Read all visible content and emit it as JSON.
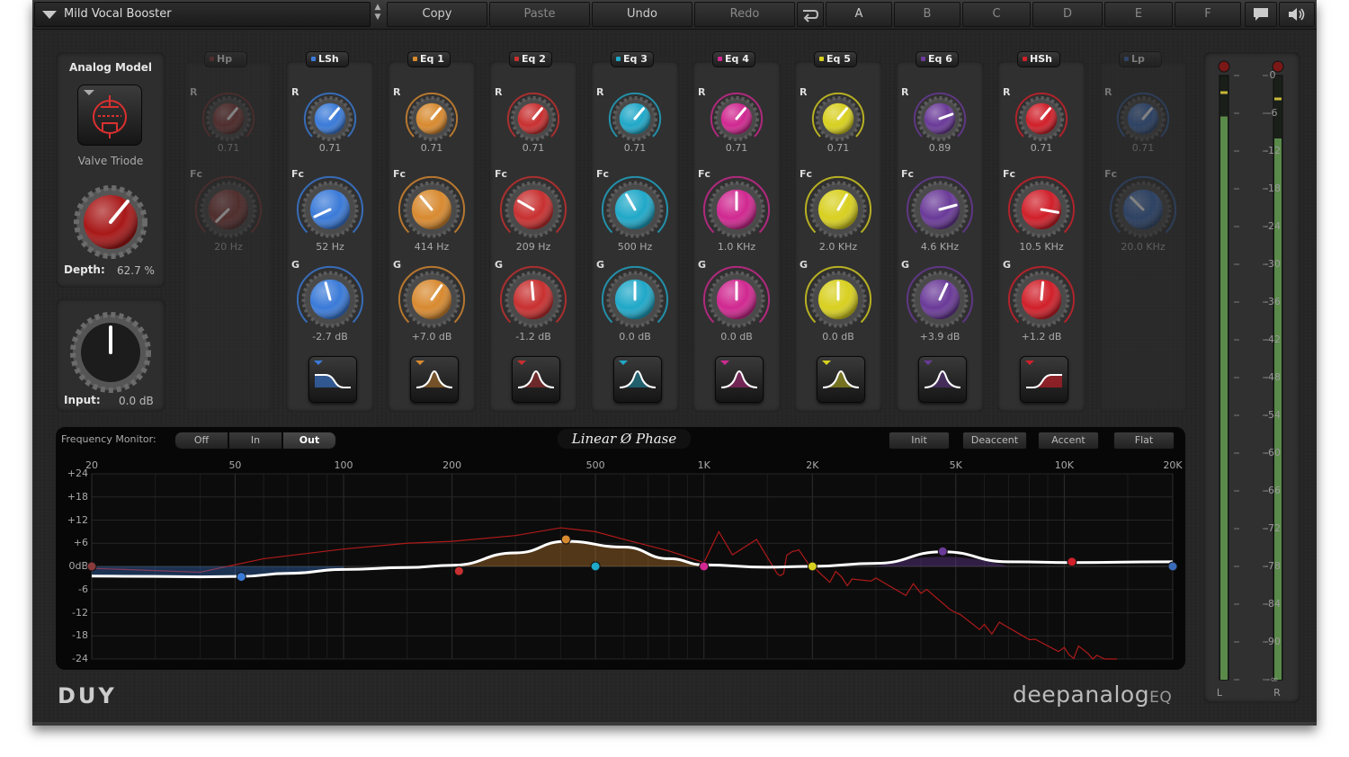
{
  "topbar": {
    "preset_name": "Mild Vocal Booster",
    "buttons": [
      {
        "label": "Copy",
        "enabled": true
      },
      {
        "label": "Paste",
        "enabled": false
      },
      {
        "label": "Undo",
        "enabled": true
      },
      {
        "label": "Redo",
        "enabled": false
      }
    ],
    "ab_slots": [
      "A",
      "B",
      "C",
      "D",
      "E",
      "F"
    ],
    "icons": [
      "swap-icon",
      "comment-icon",
      "speaker-icon"
    ]
  },
  "analog": {
    "title": "Analog Model",
    "model": "Valve Triode",
    "depth_label": "Depth:",
    "depth_value": "62.7 %",
    "input_label": "Input:",
    "input_value": "0.0 dB"
  },
  "bands": [
    {
      "tag": "Hp",
      "enabled": false,
      "color": "#8a3a3a",
      "r": "0.71",
      "fc": "20 Hz",
      "g": null,
      "shape": null
    },
    {
      "tag": "LSh",
      "enabled": true,
      "color": "#3a7ad8",
      "r": "0.71",
      "fc": "52 Hz",
      "g": "-2.7 dB",
      "shape": "low-shelf"
    },
    {
      "tag": "Eq 1",
      "enabled": true,
      "color": "#d88a30",
      "r": "0.71",
      "fc": "414 Hz",
      "g": "+7.0 dB",
      "shape": "peak"
    },
    {
      "tag": "Eq 2",
      "enabled": true,
      "color": "#c83030",
      "r": "0.71",
      "fc": "209 Hz",
      "g": "-1.2 dB",
      "shape": "peak"
    },
    {
      "tag": "Eq 3",
      "enabled": true,
      "color": "#20a8c8",
      "r": "0.71",
      "fc": "500 Hz",
      "g": "0.0 dB",
      "shape": "peak"
    },
    {
      "tag": "Eq 4",
      "enabled": true,
      "color": "#d02890",
      "r": "0.71",
      "fc": "1.0 KHz",
      "g": "0.0 dB",
      "shape": "peak"
    },
    {
      "tag": "Eq 5",
      "enabled": true,
      "color": "#d8d020",
      "r": "0.71",
      "fc": "2.0 KHz",
      "g": "0.0 dB",
      "shape": "peak"
    },
    {
      "tag": "Eq 6",
      "enabled": true,
      "color": "#6a3a98",
      "r": "0.89",
      "fc": "4.6 KHz",
      "g": "+3.9 dB",
      "shape": "peak"
    },
    {
      "tag": "HSh",
      "enabled": true,
      "color": "#d0202a",
      "r": "0.71",
      "fc": "10.5 KHz",
      "g": "+1.2 dB",
      "shape": "high-shelf"
    },
    {
      "tag": "Lp",
      "enabled": false,
      "color": "#3a6ab8",
      "r": "0.71",
      "fc": "20.0 KHz",
      "g": null,
      "shape": null
    }
  ],
  "knob_labels": {
    "r": "R",
    "fc": "Fc",
    "g": "G"
  },
  "monitor": {
    "label": "Frequency Monitor:",
    "options": [
      "Off",
      "In",
      "Out"
    ],
    "selected": "Out",
    "phase_mode": "Linear Ø Phase",
    "buttons": [
      "Init",
      "Deaccent",
      "Accent",
      "Flat"
    ]
  },
  "chart_data": {
    "type": "line",
    "x_scale": "log",
    "xlim": [
      20,
      20000
    ],
    "ylim": [
      -24,
      24
    ],
    "x_ticks": [
      "20",
      "50",
      "100",
      "200",
      "500",
      "1K",
      "2K",
      "5K",
      "10K",
      "20K"
    ],
    "x_tick_values": [
      20,
      50,
      100,
      200,
      500,
      1000,
      2000,
      5000,
      10000,
      20000
    ],
    "y_ticks": [
      "+24",
      "+18",
      "+12",
      "+6",
      "0dB",
      "-6",
      "-12",
      "-18",
      "-24"
    ],
    "y_tick_values": [
      24,
      18,
      12,
      6,
      0,
      -6,
      -12,
      -18,
      -24
    ],
    "series": [
      {
        "type": "eq-curve",
        "x": [
          20,
          30,
          40,
          52,
          70,
          100,
          150,
          200,
          300,
          414,
          600,
          800,
          1000,
          1500,
          2000,
          3000,
          4600,
          7000,
          10500,
          20000
        ],
        "y": [
          -2.5,
          -2.6,
          -2.7,
          -2.6,
          -1.8,
          -0.8,
          -0.3,
          0.3,
          3.5,
          6.5,
          5.0,
          2.0,
          0.4,
          -0.2,
          0.0,
          0.8,
          3.8,
          1.2,
          1.0,
          1.2
        ]
      },
      {
        "type": "spectrum",
        "x": [
          20,
          40,
          60,
          100,
          150,
          200,
          300,
          400,
          500,
          600,
          800,
          1000,
          1100,
          1200,
          1400,
          1600,
          1800,
          2000,
          2500,
          3000,
          4000,
          5000,
          6000,
          8000,
          10000,
          12000,
          14000
        ],
        "y": [
          -0.5,
          -1.5,
          2.0,
          4.5,
          6.0,
          6.5,
          8.0,
          10.0,
          9.0,
          7.0,
          4.0,
          1.0,
          9.0,
          3.0,
          7.0,
          -2.0,
          4.0,
          0.5,
          -5.0,
          -3.0,
          -7.0,
          -12.0,
          -15.0,
          -19.0,
          -21.0,
          -24.0,
          -24.0
        ]
      }
    ],
    "points": [
      {
        "band": "Hp",
        "freq": 20,
        "gain": 0
      },
      {
        "band": "LSh",
        "freq": 52,
        "gain": -2.7
      },
      {
        "band": "Eq 2",
        "freq": 209,
        "gain": -1.2
      },
      {
        "band": "Eq 1",
        "freq": 414,
        "gain": 7.0
      },
      {
        "band": "Eq 3",
        "freq": 500,
        "gain": 0.0
      },
      {
        "band": "Eq 4",
        "freq": 1000,
        "gain": 0.0
      },
      {
        "band": "Eq 5",
        "freq": 2000,
        "gain": 0.0
      },
      {
        "band": "Eq 6",
        "freq": 4600,
        "gain": 3.9
      },
      {
        "band": "HSh",
        "freq": 10500,
        "gain": 1.2
      },
      {
        "band": "Lp",
        "freq": 20000,
        "gain": 0
      }
    ]
  },
  "meter": {
    "scale": [
      "0",
      "-6",
      "-12",
      "-18",
      "-24",
      "-30",
      "-36",
      "-42",
      "-48",
      "-54",
      "-60",
      "-66",
      "-72",
      "-78",
      "-84",
      "-90",
      "-∞"
    ],
    "scale_values": [
      0,
      -6,
      -12,
      -18,
      -24,
      -30,
      -36,
      -42,
      -48,
      -54,
      -60,
      -66,
      -72,
      -78,
      -84,
      -90,
      -96
    ],
    "channels": [
      "L",
      "R"
    ],
    "levels": [
      -6.5,
      -10.0
    ],
    "peaks": [
      -2.5,
      -3.5
    ]
  },
  "footer": {
    "logo": "DUY",
    "brand_main": "deepanalog",
    "brand_suffix": "EQ"
  }
}
